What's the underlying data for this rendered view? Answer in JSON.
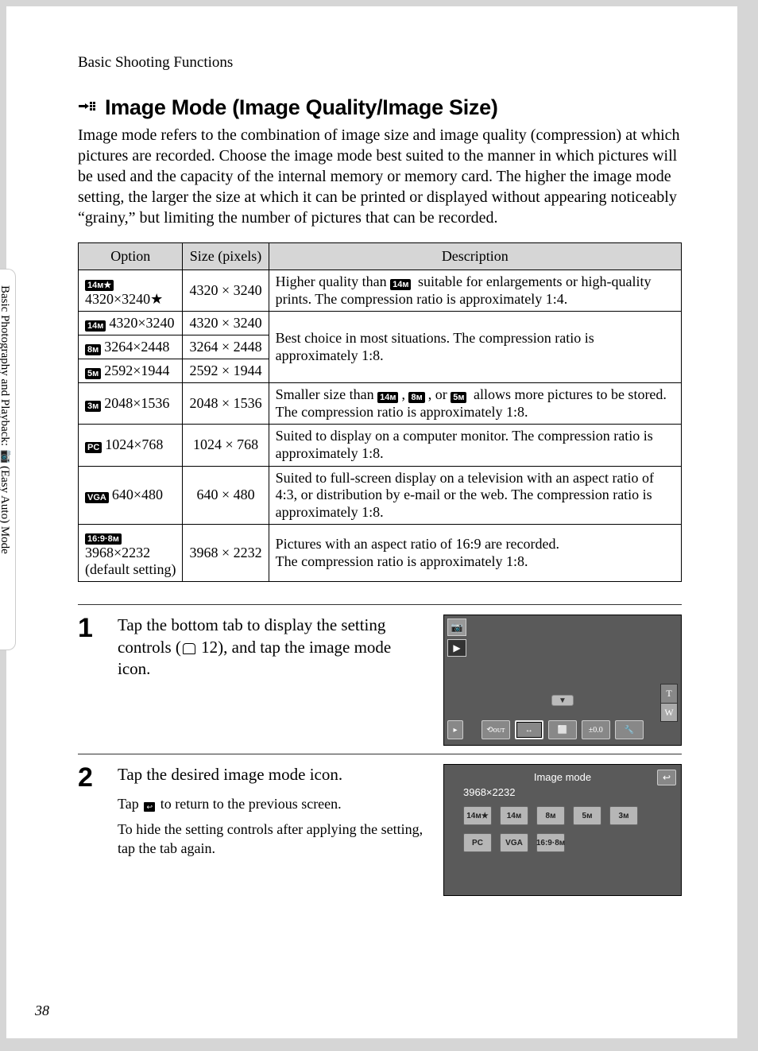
{
  "header_label": "Basic Shooting Functions",
  "side_tab": {
    "t1": "Basic Photography and Playback: ",
    "t2": " (Easy Auto) Mode"
  },
  "title": "Image Mode (Image Quality/Image Size)",
  "intro": "Image mode refers to the combination of image size and image quality (compression) at which pictures are recorded. Choose the image mode best suited to the manner in which pictures will be used and the capacity of the internal memory or memory card. The higher the image mode setting, the larger the size at which it can be printed or displayed without appearing noticeably “grainy,” but limiting the number of pictures that can be recorded.",
  "table": {
    "head": {
      "c1": "Option",
      "c2": "Size (pixels)",
      "c3": "Description"
    },
    "rows": [
      {
        "icon": "14ᴍ★",
        "opt": "4320×3240",
        "star": "★",
        "size": "4320 × 3240",
        "desc_a": "Higher quality than ",
        "desc_b": " suitable for enlargements or high-quality prints. The compression ratio is approximately 1:4.",
        "icons": {
          "i1": "14ᴍ"
        }
      },
      {
        "icon": "14ᴍ",
        "opt": "4320×3240",
        "size": "4320 × 3240",
        "desc_shared": "Best choice in most situations. The compression ratio is approximately 1:8."
      },
      {
        "icon": "8ᴍ",
        "opt": "3264×2448",
        "size": "3264 × 2448"
      },
      {
        "icon": "5ᴍ",
        "opt": "2592×1944",
        "size": "2592 × 1944"
      },
      {
        "icon": "3ᴍ",
        "opt": "2048×1536",
        "size": "2048 × 1536",
        "desc_a": "Smaller size than ",
        "desc_b": " allows more pictures to be stored. The compression ratio is approximately 1:8.",
        "icons": {
          "i1": "14ᴍ",
          "i2": "8ᴍ",
          "i3": "5ᴍ"
        },
        "sep1": ", ",
        "sep2": ", or "
      },
      {
        "icon": "PC",
        "opt": "1024×768",
        "size": "1024 × 768",
        "desc": "Suited to display on a computer monitor. The compression ratio is approximately 1:8."
      },
      {
        "icon": "VGA",
        "opt": "640×480",
        "size": "640 × 480",
        "desc": "Suited to full-screen display on a television with an aspect ratio of 4:3, or distribution by e-mail or the web. The compression ratio is approximately 1:8."
      },
      {
        "icon": "16:9·8ᴍ",
        "opt": "3968×2232",
        "sub": "(default setting)",
        "size": "3968 × 2232",
        "desc": "Pictures with an aspect ratio of 16:9 are recorded.\nThe compression ratio is approximately 1:8."
      }
    ]
  },
  "steps": {
    "s1": {
      "num": "1",
      "instr_a": "Tap the bottom tab to display the setting controls (",
      "pref": " 12",
      "instr_b": "), and tap the image mode icon."
    },
    "s2": {
      "num": "2",
      "instr": "Tap the desired image mode icon.",
      "sub1a": "Tap ",
      "sub1b": " to return to the previous screen.",
      "sub2": "To hide the setting controls after applying the setting, tap the tab again."
    }
  },
  "fig1": {
    "bottom": {
      "b0": "▸",
      "b1": "⟲ᴏᴜᴛ",
      "b2": "↔",
      "b3": "⬜",
      "b4": "±0.0",
      "b5": "🔧"
    },
    "tw": {
      "t": "T",
      "w": "W"
    },
    "arrow": "▼"
  },
  "fig2": {
    "title": "Image mode",
    "cur": "3968×2232",
    "buttons": [
      "14ᴍ★",
      "14ᴍ",
      "8ᴍ",
      "5ᴍ",
      "3ᴍ",
      "PC",
      "VGA",
      "16:9·8ᴍ"
    ],
    "back": "↩"
  },
  "page_num": "38"
}
